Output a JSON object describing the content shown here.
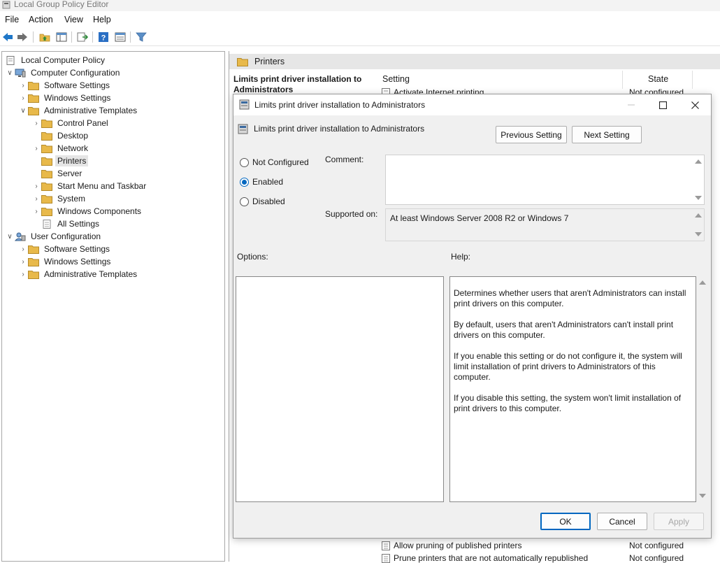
{
  "window": {
    "title": "Local Group Policy Editor"
  },
  "menu": [
    "File",
    "Action",
    "View",
    "Help"
  ],
  "toolbar_icons": [
    "back-arrow-icon",
    "forward-arrow-icon",
    "up-folder-icon",
    "show-hide-tree-icon",
    "export-list-icon",
    "help-icon",
    "properties-icon",
    "filter-icon"
  ],
  "tree": {
    "root": "Local Computer Policy",
    "computer_config": "Computer Configuration",
    "cc_software": "Software Settings",
    "cc_windows": "Windows Settings",
    "cc_admin": "Administrative Templates",
    "control_panel": "Control Panel",
    "desktop": "Desktop",
    "network": "Network",
    "printers": "Printers",
    "server": "Server",
    "start_menu": "Start Menu and Taskbar",
    "system": "System",
    "windows_components": "Windows Components",
    "all_settings": "All Settings",
    "user_config": "User Configuration",
    "uc_software": "Software Settings",
    "uc_windows": "Windows Settings",
    "uc_admin": "Administrative Templates"
  },
  "right_pane": {
    "header": "Printers",
    "extended_title": "Limits print driver installation to Administrators",
    "col_setting": "Setting",
    "col_state": "State",
    "rows_top": [
      {
        "setting": "Activate Internet printing",
        "state": "Not configured"
      }
    ],
    "rows_bottom": [
      {
        "setting": "Allow pruning of published printers",
        "state": "Not configured"
      },
      {
        "setting": "Prune printers that are not automatically republished",
        "state": "Not configured"
      }
    ]
  },
  "dialog": {
    "title": "Limits print driver installation to Administrators",
    "subtitle": "Limits print driver installation to Administrators",
    "prev_button": "Previous Setting",
    "next_button": "Next Setting",
    "radio_not_configured": "Not Configured",
    "radio_enabled": "Enabled",
    "radio_disabled": "Disabled",
    "selected_radio": "Enabled",
    "comment_label": "Comment:",
    "comment_value": "",
    "supported_label": "Supported on:",
    "supported_value": "At least Windows Server 2008 R2 or Windows 7",
    "options_label": "Options:",
    "help_label": "Help:",
    "help_paragraphs": [
      "Determines whether users that aren't Administrators can install print drivers on this computer.",
      "By default, users that aren't Administrators can't install print drivers on this computer.",
      "If you enable this setting or do not configure it, the system will limit installation of print drivers to Administrators of this computer.",
      "If you disable this setting, the system won't limit installation of print drivers to this computer."
    ],
    "ok_button": "OK",
    "cancel_button": "Cancel",
    "apply_button": "Apply"
  },
  "colors": {
    "accent": "#0067c0",
    "folder": "#e8b94a",
    "selection": "#e5e5e5"
  }
}
